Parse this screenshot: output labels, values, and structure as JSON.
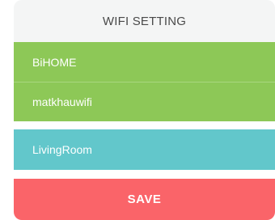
{
  "header": {
    "title": "WIFI SETTING"
  },
  "form": {
    "ssid_value": "BiHOME",
    "password_value": "matkhauwifi",
    "room_value": "LivingRoom"
  },
  "actions": {
    "save_label": "SAVE"
  },
  "colors": {
    "header_bg": "#f4f5f5",
    "wifi_fields": "#8dc857",
    "room_field": "#62c7cb",
    "save_button": "#fa6469"
  }
}
